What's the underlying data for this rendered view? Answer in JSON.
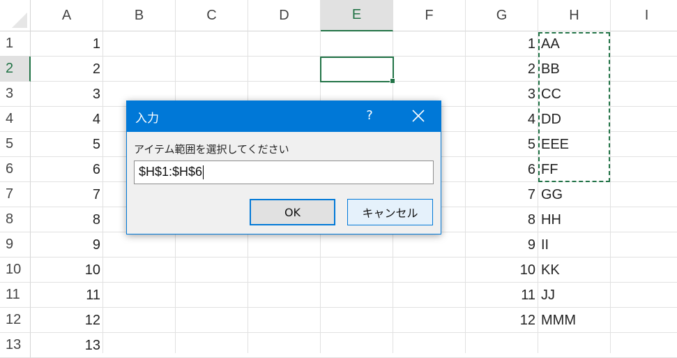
{
  "columns": [
    "A",
    "B",
    "C",
    "D",
    "E",
    "F",
    "G",
    "H",
    "I"
  ],
  "active_column": "E",
  "rows": [
    "1",
    "2",
    "3",
    "4",
    "5",
    "6",
    "7",
    "8",
    "9",
    "10",
    "11",
    "12",
    "13"
  ],
  "active_row": "2",
  "col_a_values": [
    "1",
    "2",
    "3",
    "4",
    "5",
    "6",
    "7",
    "8",
    "9",
    "10",
    "11",
    "12",
    "13"
  ],
  "col_g_values": [
    "1",
    "2",
    "3",
    "4",
    "5",
    "6",
    "7",
    "8",
    "9",
    "10",
    "11",
    "12"
  ],
  "col_h_values": [
    "AA",
    "BB",
    "CC",
    "DD",
    "EEE",
    "FF",
    "GG",
    "HH",
    "II",
    "KK",
    "JJ",
    "MMM"
  ],
  "dialog": {
    "title": "入力",
    "help": "?",
    "prompt": "アイテム範囲を選択してください",
    "input_value": "$H$1:$H$6",
    "ok_label": "OK",
    "cancel_label": "キャンセル"
  },
  "colors": {
    "accent": "#217346",
    "dialog_blue": "#0078d7"
  },
  "icons": [
    "close-icon",
    "help-icon",
    "select-all-triangle-icon"
  ]
}
